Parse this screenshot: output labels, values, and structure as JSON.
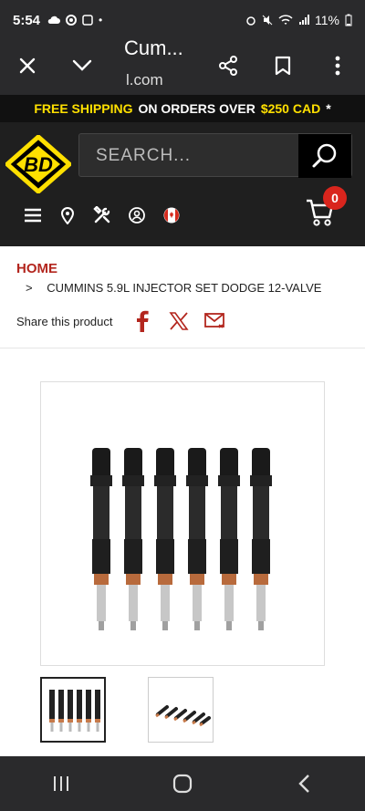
{
  "status_bar": {
    "time": "5:54",
    "battery": "11%"
  },
  "browser": {
    "title": "Cum...",
    "url": "l.com",
    "icons": [
      "close-icon",
      "chevron-down-icon",
      "share-icon",
      "bookmark-icon",
      "more-vert-icon"
    ]
  },
  "shipping_banner": {
    "part1": "FREE SHIPPING",
    "part2": "ON ORDERS OVER",
    "amount": "$250 CAD",
    "asterisk": "*"
  },
  "header": {
    "logo_text": "BD",
    "search_placeholder": "SEARCH...",
    "cart_count": "0",
    "accent": "#ffe000"
  },
  "breadcrumb": {
    "home": "HOME",
    "separator": ">",
    "current": "CUMMINS 5.9L INJECTOR SET DODGE 12-VALVE"
  },
  "share": {
    "label": "Share this product"
  },
  "colors": {
    "brand_red": "#b3261e",
    "dark": "#1f1f1f"
  }
}
